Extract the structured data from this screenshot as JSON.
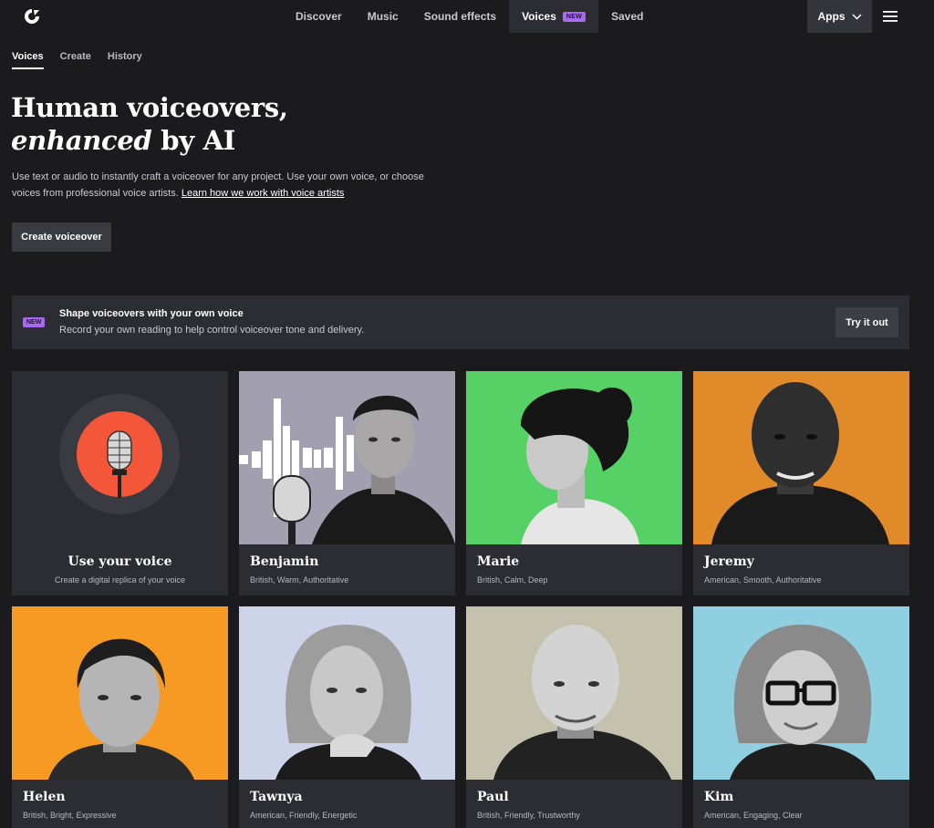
{
  "nav": {
    "links": [
      "Discover",
      "Music",
      "Sound effects",
      "Voices",
      "Saved"
    ],
    "new_badge": "NEW",
    "apps_label": "Apps"
  },
  "subtabs": [
    "Voices",
    "Create",
    "History"
  ],
  "hero": {
    "title_line1": "Human voiceovers,",
    "title_em": "enhanced",
    "title_rest": " by AI",
    "desc": "Use text or audio to instantly craft a voiceover for any project. Use your own voice, or choose voices from professional voice artists. ",
    "desc_link": "Learn how we work with voice artists",
    "cta": "Create voiceover"
  },
  "banner": {
    "badge": "NEW",
    "title": "Shape voiceovers with your own voice",
    "subtitle": "Record your own reading to help control voiceover tone and delivery.",
    "button": "Try it out"
  },
  "own_voice": {
    "title": "Use your voice",
    "subtitle": "Create a digital replica of your voice"
  },
  "voices": [
    {
      "name": "Benjamin",
      "tags": "British, Warm, Authoritative",
      "bg": "#a19fb0"
    },
    {
      "name": "Marie",
      "tags": "British, Calm, Deep",
      "bg": "#55d165"
    },
    {
      "name": "Jeremy",
      "tags": "American, Smooth, Authoritative",
      "bg": "#e08a2a"
    },
    {
      "name": "Helen",
      "tags": "British, Bright, Expressive",
      "bg": "#f79a24"
    },
    {
      "name": "Tawnya",
      "tags": "American, Friendly, Energetic",
      "bg": "#cdd3e8"
    },
    {
      "name": "Paul",
      "tags": "British, Friendly, Trustworthy",
      "bg": "#c4c1ac"
    },
    {
      "name": "Kim",
      "tags": "American, Engaging, Clear",
      "bg": "#8fcfe0"
    }
  ],
  "colors": {
    "background": "#1b1b1e",
    "surface": "#2c2d33",
    "accent_purple": "#a868f0",
    "mic_orange": "#f4563a"
  }
}
